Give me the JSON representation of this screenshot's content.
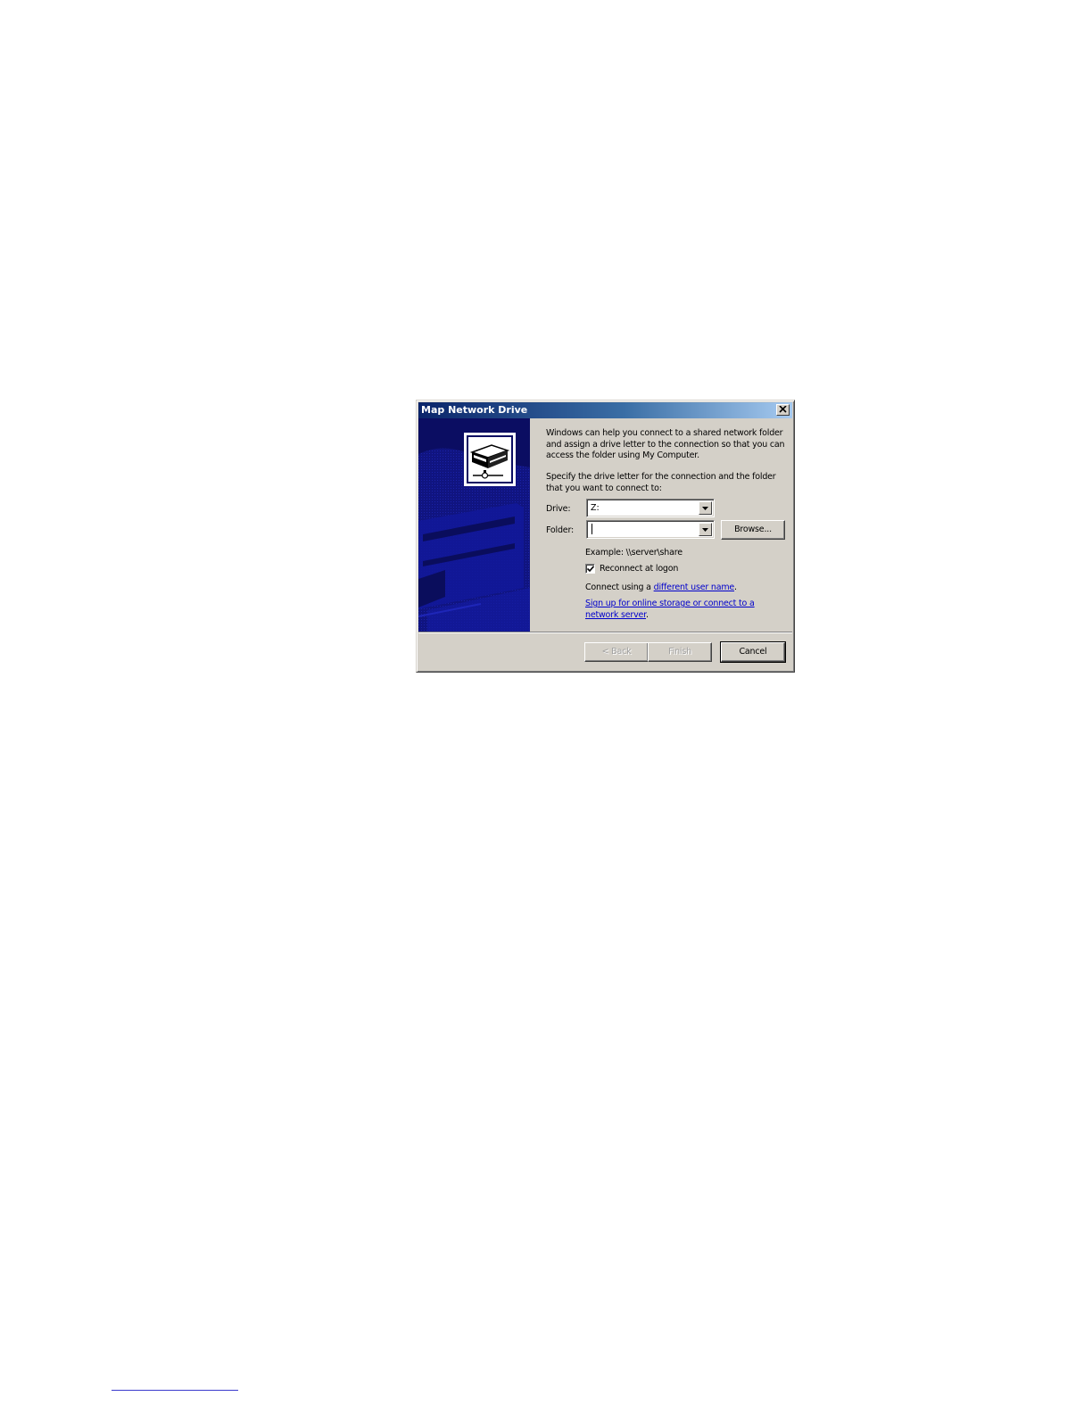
{
  "dialog": {
    "title": "Map Network Drive",
    "close_icon": "close-icon",
    "banner_icon": "network-drive-icon",
    "intro_text": "Windows can help you connect to a shared network folder and assign a drive letter to the connection so that you can access the folder using My Computer.",
    "specify_text": "Specify the drive letter for the connection and the folder that you want to connect to:",
    "drive": {
      "label": "Drive:",
      "value": "Z:"
    },
    "folder": {
      "label": "Folder:",
      "value": ""
    },
    "browse_label": "Browse...",
    "example_text": "Example: \\\\server\\share",
    "reconnect": {
      "label": "Reconnect at logon",
      "checked": true
    },
    "connect_prefix": "Connect using a ",
    "connect_link": "different user name",
    "connect_suffix": ".",
    "signup_link": "Sign up for online storage or connect to a network server",
    "signup_suffix": ".",
    "buttons": {
      "back": "< Back",
      "finish": "Finish",
      "cancel": "Cancel"
    },
    "colors": {
      "face": "#d4d0c8",
      "title_start": "#0a246a",
      "title_end": "#a6caf0",
      "banner": "#0d0f6e",
      "link": "#0000cc"
    }
  }
}
